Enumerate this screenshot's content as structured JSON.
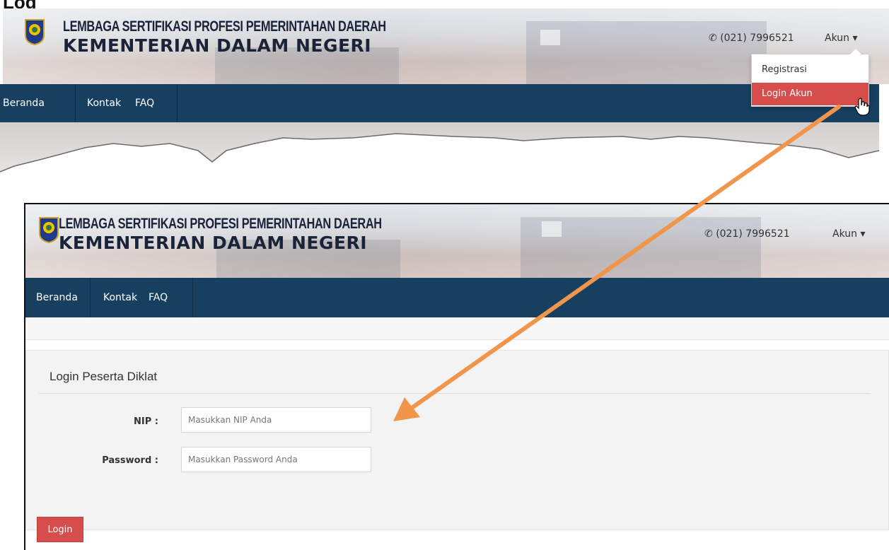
{
  "top_label": "Log",
  "header": {
    "brand_line1": "LEMBAGA SERTIFIKASI PROFESI PEMERINTAHAN DAERAH",
    "brand_line2": "KEMENTERIAN DALAM NEGERI",
    "phone_icon": "phone-icon",
    "phone": "(021) 7996521",
    "account_label": "Akun",
    "account_caret": "▾"
  },
  "nav": {
    "items": [
      "Beranda",
      "Kontak",
      "FAQ"
    ]
  },
  "dropdown": {
    "items": [
      {
        "label": "Registrasi",
        "active": false
      },
      {
        "label": "Login Akun",
        "active": true
      }
    ]
  },
  "login_form": {
    "title": "Login Peserta Diklat",
    "nip_label": "NIP :",
    "nip_placeholder": "Masukkan NIP Anda",
    "password_label": "Password :",
    "password_placeholder": "Masukkan Password Anda",
    "submit_label": "Login"
  },
  "colors": {
    "navbar": "#173f5f",
    "accent_red": "#d64d4b",
    "arrow": "#f0954a"
  }
}
